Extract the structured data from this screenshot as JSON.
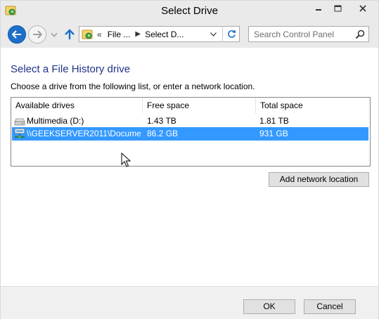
{
  "window": {
    "title": "Select Drive"
  },
  "navigation": {
    "address_crumbs": [
      "File ...",
      "Select D..."
    ],
    "address_chevrons": "«",
    "search_placeholder": "Search Control Panel"
  },
  "content": {
    "heading": "Select a File History drive",
    "instructions": "Choose a drive from the following list, or enter a network location."
  },
  "drive_list": {
    "columns": [
      "Available drives",
      "Free space",
      "Total space"
    ],
    "rows": [
      {
        "name": "Multimedia (D:)",
        "free": "1.43 TB",
        "total": "1.81 TB",
        "icon": "hard-drive-icon",
        "selected": false
      },
      {
        "name": "\\\\GEEKSERVER2011\\Docume...",
        "free": "86.2 GB",
        "total": "931 GB",
        "icon": "network-drive-icon",
        "selected": true
      }
    ]
  },
  "buttons": {
    "add_network_location": "Add network location",
    "ok": "OK",
    "cancel": "Cancel"
  },
  "colors": {
    "heading": "#1e3287",
    "selection": "#3399ff",
    "back_button": "#1e6fc8"
  }
}
